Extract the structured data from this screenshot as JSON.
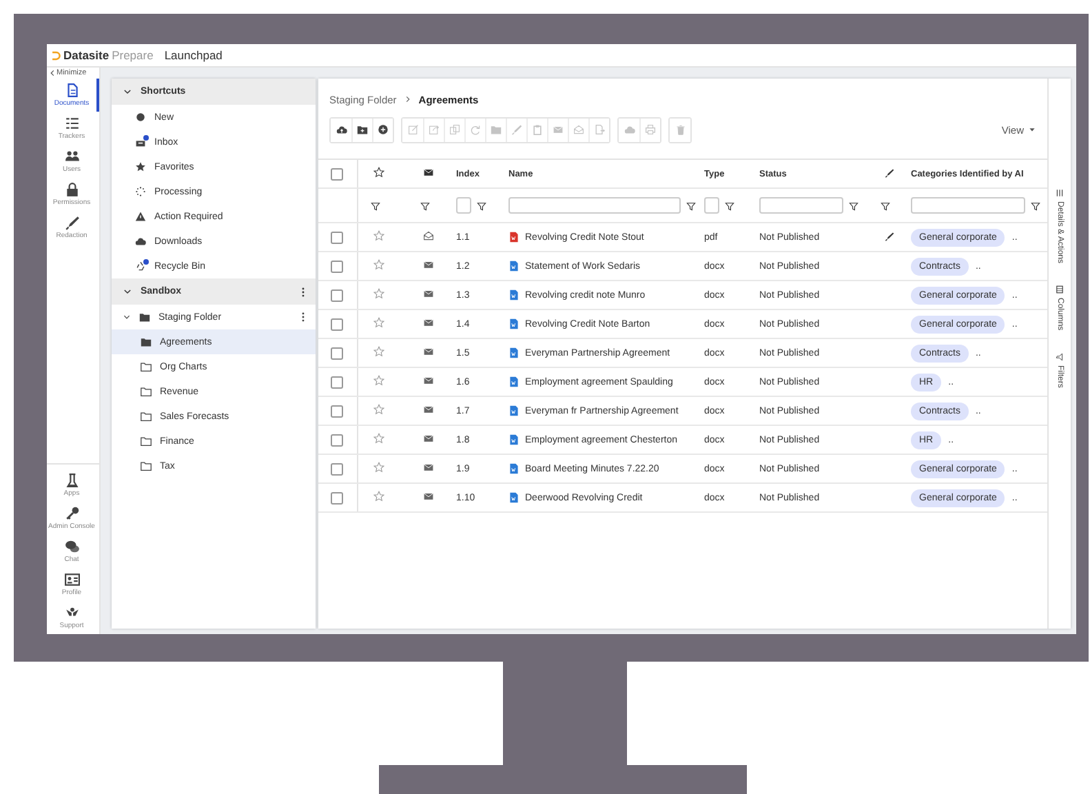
{
  "app": {
    "logo": "Datasite",
    "product": "Prepare",
    "title": "Launchpad"
  },
  "nav": {
    "minimize": "Minimize",
    "top_items": [
      {
        "label": "Documents",
        "selected": true
      },
      {
        "label": "Trackers",
        "selected": false
      },
      {
        "label": "Users",
        "selected": false
      },
      {
        "label": "Permissions",
        "selected": false
      },
      {
        "label": "Redaction",
        "selected": false
      }
    ],
    "bottom_items": [
      {
        "label": "Apps",
        "selected": false
      },
      {
        "label": "Admin Console",
        "selected": false
      },
      {
        "label": "Chat",
        "selected": false
      },
      {
        "label": "Profile",
        "selected": false
      },
      {
        "label": "Support",
        "selected": false
      }
    ]
  },
  "shortcuts": {
    "title": "Shortcuts",
    "expanded": true,
    "items": [
      {
        "label": "New",
        "unread": false
      },
      {
        "label": "Inbox",
        "unread": true
      },
      {
        "label": "Favorites",
        "unread": false
      },
      {
        "label": "Processing",
        "unread": false
      },
      {
        "label": "Action Required",
        "unread": false
      },
      {
        "label": "Downloads",
        "unread": false
      },
      {
        "label": "Recycle Bin",
        "unread": true
      }
    ]
  },
  "sandbox": {
    "title": "Sandbox",
    "expanded": true,
    "tree": [
      {
        "label": "Staging Folder",
        "expanded": true,
        "selected": false,
        "children": [
          {
            "label": "Agreements",
            "selected": true
          },
          {
            "label": "Org Charts",
            "selected": false
          },
          {
            "label": "Revenue",
            "selected": false
          },
          {
            "label": "Sales Forecasts",
            "selected": false
          },
          {
            "label": "Finance",
            "selected": false
          },
          {
            "label": "Tax",
            "selected": false
          }
        ]
      }
    ]
  },
  "breadcrumb": [
    "Staging Folder",
    "Agreements"
  ],
  "toolbar": {
    "groups": [
      [
        {
          "disabled": false
        },
        {
          "disabled": false
        },
        {
          "disabled": false
        }
      ],
      [
        {
          "disabled": true
        },
        {
          "disabled": true
        },
        {
          "disabled": true
        },
        {
          "disabled": true
        },
        {
          "disabled": true
        },
        {
          "disabled": true
        },
        {
          "disabled": true
        },
        {
          "disabled": true
        },
        {
          "disabled": true
        },
        {
          "disabled": true
        }
      ],
      [
        {
          "disabled": true
        },
        {
          "disabled": true
        }
      ],
      [
        {
          "disabled": true
        }
      ]
    ],
    "view": "View"
  },
  "table": {
    "columns": [
      {
        "kind": "checkbox",
        "checked": false
      },
      {
        "kind": "star",
        "filter": {
          "kind": "icon"
        }
      },
      {
        "kind": "mail",
        "filter": {
          "kind": "icon"
        }
      },
      {
        "kind": "text",
        "label": "Index",
        "filter": {
          "kind": "small"
        }
      },
      {
        "kind": "text",
        "label": "Name",
        "filter": {
          "kind": "wide"
        }
      },
      {
        "kind": "text",
        "label": "Type",
        "filter": {
          "kind": "small"
        }
      },
      {
        "kind": "text",
        "label": "Status",
        "filter": {
          "kind": "wide"
        }
      },
      {
        "kind": "pen",
        "filter": {
          "kind": "icon"
        }
      },
      {
        "kind": "text",
        "label": "Categories Identified by AI",
        "filter": {
          "kind": "wide"
        }
      }
    ],
    "rows": [
      {
        "checked": false,
        "starred": false,
        "read": true,
        "index": "1.1",
        "kind": "pdf",
        "name": "Revolving Credit Note Stout",
        "type": "pdf",
        "status": "Not Published",
        "annotated": true,
        "category": "General corporate",
        "more": ".."
      },
      {
        "checked": false,
        "starred": false,
        "read": false,
        "index": "1.2",
        "kind": "doc",
        "name": "Statement of Work Sedaris",
        "type": "docx",
        "status": "Not Published",
        "annotated": false,
        "category": "Contracts",
        "more": ".."
      },
      {
        "checked": false,
        "starred": false,
        "read": false,
        "index": "1.3",
        "kind": "doc",
        "name": "Revolving credit note Munro",
        "type": "docx",
        "status": "Not Published",
        "annotated": false,
        "category": "General corporate",
        "more": ".."
      },
      {
        "checked": false,
        "starred": false,
        "read": false,
        "index": "1.4",
        "kind": "doc",
        "name": "Revolving Credit Note Barton",
        "type": "docx",
        "status": "Not Published",
        "annotated": false,
        "category": "General corporate",
        "more": ".."
      },
      {
        "checked": false,
        "starred": false,
        "read": false,
        "index": "1.5",
        "kind": "doc",
        "name": "Everyman Partnership Agreement",
        "type": "docx",
        "status": "Not Published",
        "annotated": false,
        "category": "Contracts",
        "more": ".."
      },
      {
        "checked": false,
        "starred": false,
        "read": false,
        "index": "1.6",
        "kind": "doc",
        "name": "Employment agreement Spaulding",
        "type": "docx",
        "status": "Not Published",
        "annotated": false,
        "category": "HR",
        "more": ".."
      },
      {
        "checked": false,
        "starred": false,
        "read": false,
        "index": "1.7",
        "kind": "doc",
        "name": "Everyman fr Partnership Agreement",
        "type": "docx",
        "status": "Not Published",
        "annotated": false,
        "category": "Contracts",
        "more": ".."
      },
      {
        "checked": false,
        "starred": false,
        "read": false,
        "index": "1.8",
        "kind": "doc",
        "name": "Employment agreement Chesterton",
        "type": "docx",
        "status": "Not Published",
        "annotated": false,
        "category": "HR",
        "more": ".."
      },
      {
        "checked": false,
        "starred": false,
        "read": false,
        "index": "1.9",
        "kind": "doc",
        "name": "Board Meeting Minutes 7.22.20",
        "type": "docx",
        "status": "Not Published",
        "annotated": false,
        "category": "General corporate",
        "more": ".."
      },
      {
        "checked": false,
        "starred": false,
        "read": false,
        "index": "1.10",
        "kind": "doc",
        "name": "Deerwood Revolving Credit",
        "type": "docx",
        "status": "Not Published",
        "annotated": false,
        "category": "General corporate",
        "more": ".."
      }
    ]
  },
  "side_tabs": [
    "Details & Actions",
    "Columns",
    "Filters"
  ]
}
